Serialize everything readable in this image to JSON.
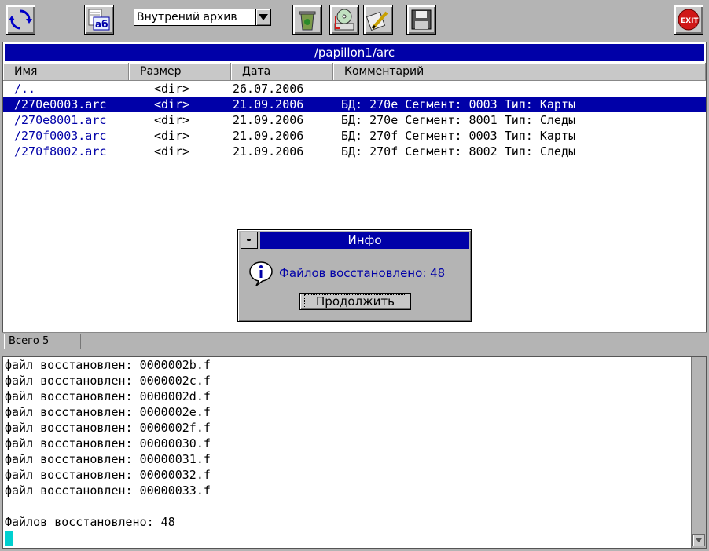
{
  "toolbar": {
    "archive_select_value": "Внутрений архив",
    "exit_label": "EXIT",
    "font_button_label": "аб"
  },
  "panel": {
    "path": "/papillon1/arc",
    "columns": [
      "Имя",
      "Размер",
      "Дата",
      "Комментарий"
    ],
    "rows": [
      {
        "name": "/..",
        "size": "<dir>",
        "date": "26.07.2006",
        "comment": "",
        "selected": false
      },
      {
        "name": "/270e0003.arc",
        "size": "<dir>",
        "date": "21.09.2006",
        "comment": "БД: 270e Сегмент: 0003 Тип: Карты",
        "selected": true
      },
      {
        "name": "/270e8001.arc",
        "size": "<dir>",
        "date": "21.09.2006",
        "comment": "БД: 270e Сегмент: 8001 Тип: Следы",
        "selected": false
      },
      {
        "name": "/270f0003.arc",
        "size": "<dir>",
        "date": "21.09.2006",
        "comment": "БД: 270f Сегмент: 0003 Тип: Карты",
        "selected": false
      },
      {
        "name": "/270f8002.arc",
        "size": "<dir>",
        "date": "21.09.2006",
        "comment": "БД: 270f Сегмент: 8002 Тип: Следы",
        "selected": false
      }
    ]
  },
  "status": {
    "total": "Всего 5"
  },
  "log": {
    "lines": [
      "файл восстановлен: 0000002b.f",
      "файл восстановлен: 0000002c.f",
      "файл восстановлен: 0000002d.f",
      "файл восстановлен: 0000002e.f",
      "файл восстановлен: 0000002f.f",
      "файл восстановлен: 00000030.f",
      "файл восстановлен: 00000031.f",
      "файл восстановлен: 00000032.f",
      "файл восстановлен: 00000033.f",
      "",
      "Файлов восстановлено: 48"
    ]
  },
  "dialog": {
    "title": "Инфо",
    "message": "Файлов восстановлено: 48",
    "button": "Продолжить"
  },
  "colors": {
    "selection": "#0000a8",
    "cursor": "#00d0d0",
    "exit_red": "#d01818"
  }
}
